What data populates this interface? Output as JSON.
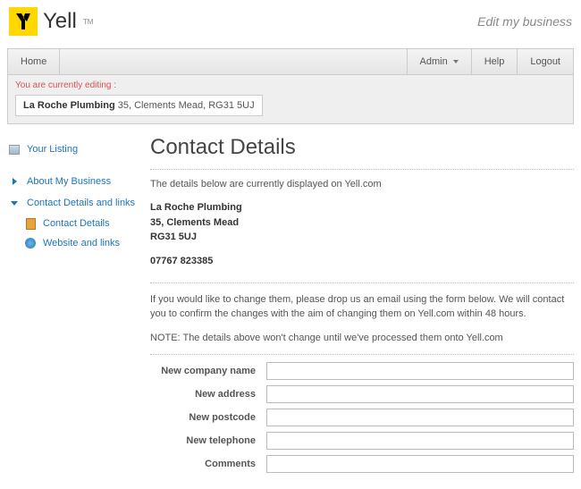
{
  "header": {
    "brand": "Yell",
    "tm": "TM",
    "tagline": "Edit my business"
  },
  "nav": {
    "home": "Home",
    "admin": "Admin",
    "help": "Help",
    "logout": "Logout"
  },
  "editing": {
    "label": "You are currently editing :",
    "business_name": "La Roche Plumbing",
    "address": "35, Clements Mead, RG31 5UJ"
  },
  "sidebar": {
    "your_listing": "Your Listing",
    "about": "About My Business",
    "contact_section": "Contact Details and links",
    "contact_details": "Contact Details",
    "website_links": "Website and links"
  },
  "content": {
    "title": "Contact Details",
    "intro": "The details below are currently displayed on Yell.com",
    "business": {
      "name": "La Roche Plumbing",
      "addr1": "35, Clements Mead",
      "postcode": "RG31 5UJ",
      "phone": "07767 823385"
    },
    "note1": "If you would like to change them, please drop us an email using the form below. We will contact you to confirm the changes with the aim of changing them on Yell.com within 48 hours.",
    "note2": "NOTE: The details above won't change until we've processed them onto Yell.com",
    "form": {
      "company": "New company name",
      "address": "New address",
      "postcode": "New postcode",
      "telephone": "New telephone",
      "comments": "Comments"
    }
  }
}
